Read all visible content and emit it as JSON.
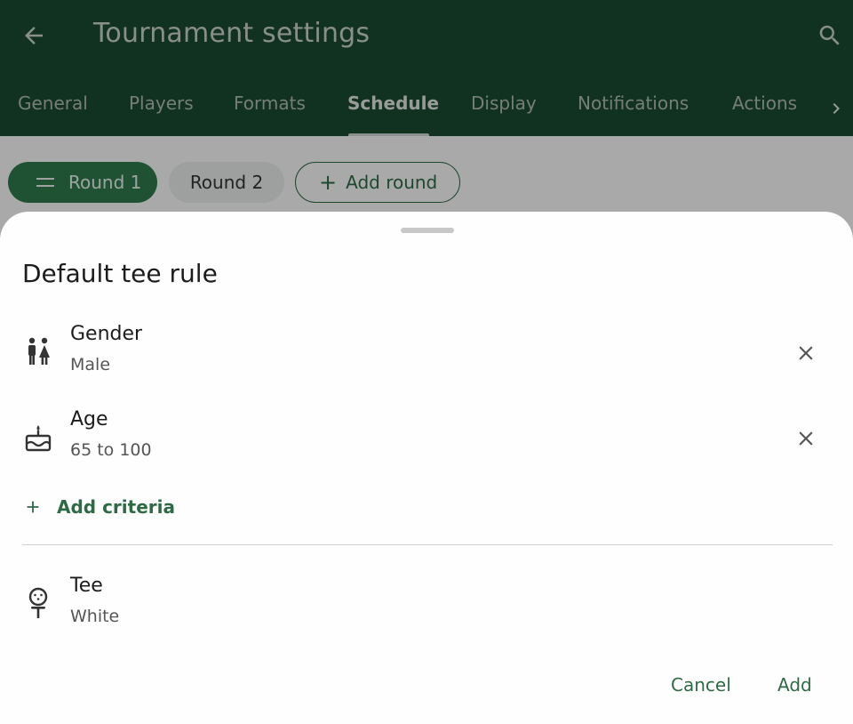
{
  "app_bar": {
    "title": "Tournament settings",
    "back_icon": "arrow-back-icon",
    "search_icon": "search-icon",
    "color": "#1b4a32"
  },
  "tabs": [
    {
      "label": "General"
    },
    {
      "label": "Players"
    },
    {
      "label": "Formats"
    },
    {
      "label": "Schedule",
      "active": true
    },
    {
      "label": "Display"
    },
    {
      "label": "Notifications"
    },
    {
      "label": "Actions"
    }
  ],
  "rounds": {
    "round1": "Round 1",
    "round2": "Round 2",
    "add_round": "Add round"
  },
  "sheet": {
    "title": "Default tee rule",
    "criteria": [
      {
        "label": "Gender",
        "value": "Male",
        "icon": "gender-icon"
      },
      {
        "label": "Age",
        "value": "65 to 100",
        "icon": "cake-icon"
      }
    ],
    "add_criteria": "Add criteria",
    "tee": {
      "label": "Tee",
      "value": "White",
      "icon": "golf-tee-icon"
    },
    "cancel": "Cancel",
    "add": "Add"
  },
  "colors": {
    "accent": "#2d6b45",
    "chip_active": "#2d7a4c"
  }
}
